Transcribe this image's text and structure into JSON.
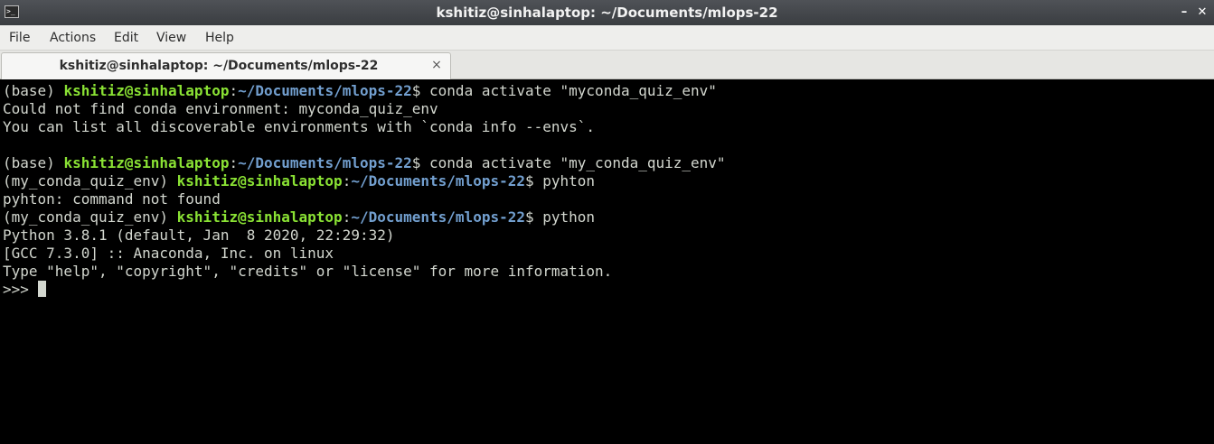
{
  "window": {
    "title": "kshitiz@sinhalaptop: ~/Documents/mlops-22",
    "icon": "terminal-icon",
    "minimize_label": "–",
    "close_label": "✕"
  },
  "menu": {
    "items": [
      "File",
      "Actions",
      "Edit",
      "View",
      "Help"
    ]
  },
  "tab": {
    "label": "kshitiz@sinhalaptop: ~/Documents/mlops-22",
    "close_label": "×"
  },
  "terminal": {
    "colors": {
      "background": "#000000",
      "foreground": "#d3d7cf",
      "user_host": "#8ae234",
      "path": "#729fcf"
    },
    "lines": [
      {
        "env": "(base) ",
        "user": "kshitiz@sinhalaptop",
        "sep": ":",
        "path": "~/Documents/mlops-22",
        "cmd": "$ conda activate \"myconda_quiz_env\""
      },
      {
        "text": "Could not find conda environment: myconda_quiz_env"
      },
      {
        "text": "You can list all discoverable environments with `conda info --envs`."
      },
      {
        "text": ""
      },
      {
        "env": "(base) ",
        "user": "kshitiz@sinhalaptop",
        "sep": ":",
        "path": "~/Documents/mlops-22",
        "cmd": "$ conda activate \"my_conda_quiz_env\""
      },
      {
        "env": "(my_conda_quiz_env) ",
        "user": "kshitiz@sinhalaptop",
        "sep": ":",
        "path": "~/Documents/mlops-22",
        "cmd": "$ pyhton"
      },
      {
        "text": "pyhton: command not found"
      },
      {
        "env": "(my_conda_quiz_env) ",
        "user": "kshitiz@sinhalaptop",
        "sep": ":",
        "path": "~/Documents/mlops-22",
        "cmd": "$ python"
      },
      {
        "text": "Python 3.8.1 (default, Jan  8 2020, 22:29:32)"
      },
      {
        "text": "[GCC 7.3.0] :: Anaconda, Inc. on linux"
      },
      {
        "text": "Type \"help\", \"copyright\", \"credits\" or \"license\" for more information."
      }
    ],
    "repl_prompt": ">>> "
  }
}
